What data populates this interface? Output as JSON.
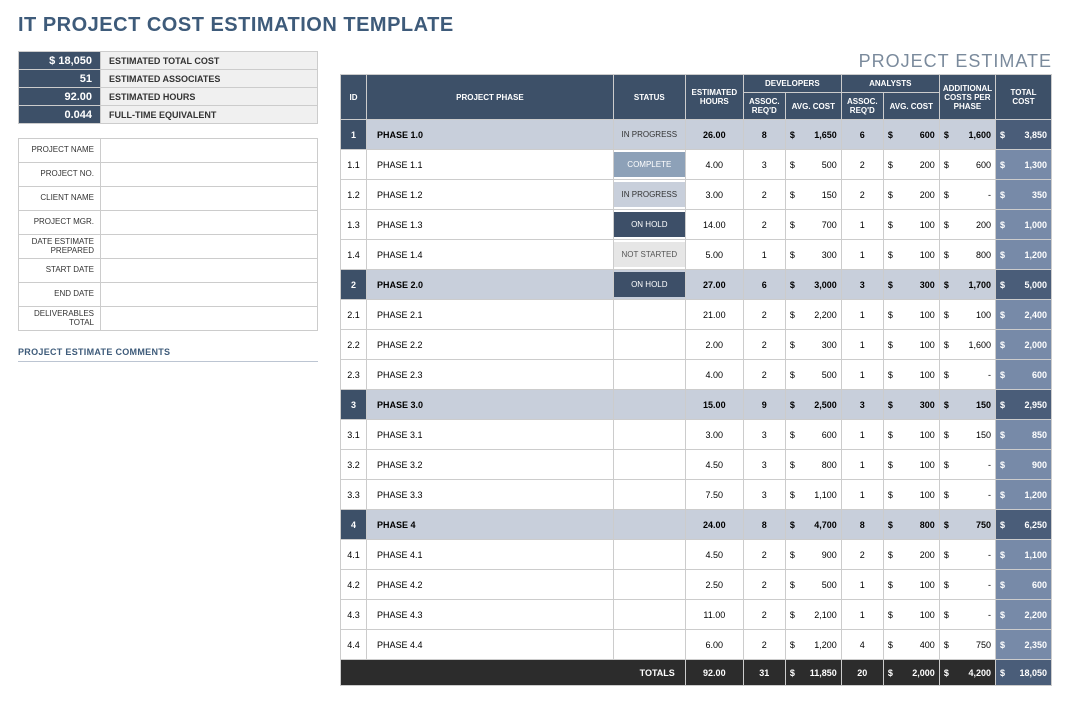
{
  "title": "IT PROJECT COST ESTIMATION TEMPLATE",
  "subtitle": "PROJECT ESTIMATE",
  "summary": {
    "total_cost": "$       18,050",
    "associates": "51",
    "hours": "92.00",
    "fte": "0.044",
    "labels": {
      "total_cost": "ESTIMATED TOTAL COST",
      "associates": "ESTIMATED ASSOCIATES",
      "hours": "ESTIMATED HOURS",
      "fte": "FULL-TIME EQUIVALENT"
    }
  },
  "info": {
    "labels": {
      "project_name": "PROJECT NAME",
      "project_no": "PROJECT NO.",
      "client_name": "CLIENT NAME",
      "project_mgr": "PROJECT MGR.",
      "date_prepared": "DATE ESTIMATE PREPARED",
      "start_date": "START DATE",
      "end_date": "END DATE",
      "deliverables": "DELIVERABLES TOTAL"
    },
    "values": {
      "project_name": "",
      "project_no": "",
      "client_name": "",
      "project_mgr": "",
      "date_prepared": "",
      "start_date": "",
      "end_date": "",
      "deliverables": ""
    }
  },
  "comments_heading": "PROJECT ESTIMATE COMMENTS",
  "headers": {
    "id": "ID",
    "phase": "PROJECT PHASE",
    "status": "STATUS",
    "hours": "ESTIMATED HOURS",
    "developers": "DEVELOPERS",
    "analysts": "ANALYSTS",
    "assoc_reqd": "ASSOC. REQ'D",
    "avg_cost": "AVG. COST",
    "additional": "ADDITIONAL COSTS PER PHASE",
    "total": "TOTAL COST",
    "totals_label": "TOTALS"
  },
  "status_classes": {
    "IN PROGRESS": "st-inprogress",
    "COMPLETE": "st-complete",
    "ON HOLD": "st-onhold",
    "NOT STARTED": "st-notstarted"
  },
  "rows": [
    {
      "type": "phase",
      "id": "1",
      "phase": "PHASE 1.0",
      "status": "IN PROGRESS",
      "hours": "26.00",
      "dev_n": "8",
      "dev_cost": "1,650",
      "an_n": "6",
      "an_cost": "600",
      "addl": "1,600",
      "total": "3,850"
    },
    {
      "type": "sub",
      "id": "1.1",
      "phase": "PHASE 1.1",
      "status": "COMPLETE",
      "hours": "4.00",
      "dev_n": "3",
      "dev_cost": "500",
      "an_n": "2",
      "an_cost": "200",
      "addl": "600",
      "total": "1,300"
    },
    {
      "type": "sub",
      "id": "1.2",
      "phase": "PHASE 1.2",
      "status": "IN PROGRESS",
      "hours": "3.00",
      "dev_n": "2",
      "dev_cost": "150",
      "an_n": "2",
      "an_cost": "200",
      "addl": "-",
      "total": "350"
    },
    {
      "type": "sub",
      "id": "1.3",
      "phase": "PHASE 1.3",
      "status": "ON HOLD",
      "hours": "14.00",
      "dev_n": "2",
      "dev_cost": "700",
      "an_n": "1",
      "an_cost": "100",
      "addl": "200",
      "total": "1,000"
    },
    {
      "type": "sub",
      "id": "1.4",
      "phase": "PHASE 1.4",
      "status": "NOT STARTED",
      "hours": "5.00",
      "dev_n": "1",
      "dev_cost": "300",
      "an_n": "1",
      "an_cost": "100",
      "addl": "800",
      "total": "1,200"
    },
    {
      "type": "phase",
      "id": "2",
      "phase": "PHASE 2.0",
      "status": "ON HOLD",
      "hours": "27.00",
      "dev_n": "6",
      "dev_cost": "3,000",
      "an_n": "3",
      "an_cost": "300",
      "addl": "1,700",
      "total": "5,000"
    },
    {
      "type": "sub",
      "id": "2.1",
      "phase": "PHASE 2.1",
      "status": "",
      "hours": "21.00",
      "dev_n": "2",
      "dev_cost": "2,200",
      "an_n": "1",
      "an_cost": "100",
      "addl": "100",
      "total": "2,400"
    },
    {
      "type": "sub",
      "id": "2.2",
      "phase": "PHASE 2.2",
      "status": "",
      "hours": "2.00",
      "dev_n": "2",
      "dev_cost": "300",
      "an_n": "1",
      "an_cost": "100",
      "addl": "1,600",
      "total": "2,000"
    },
    {
      "type": "sub",
      "id": "2.3",
      "phase": "PHASE 2.3",
      "status": "",
      "hours": "4.00",
      "dev_n": "2",
      "dev_cost": "500",
      "an_n": "1",
      "an_cost": "100",
      "addl": "-",
      "total": "600"
    },
    {
      "type": "phase",
      "id": "3",
      "phase": "PHASE 3.0",
      "status": "",
      "hours": "15.00",
      "dev_n": "9",
      "dev_cost": "2,500",
      "an_n": "3",
      "an_cost": "300",
      "addl": "150",
      "total": "2,950"
    },
    {
      "type": "sub",
      "id": "3.1",
      "phase": "PHASE 3.1",
      "status": "",
      "hours": "3.00",
      "dev_n": "3",
      "dev_cost": "600",
      "an_n": "1",
      "an_cost": "100",
      "addl": "150",
      "total": "850"
    },
    {
      "type": "sub",
      "id": "3.2",
      "phase": "PHASE 3.2",
      "status": "",
      "hours": "4.50",
      "dev_n": "3",
      "dev_cost": "800",
      "an_n": "1",
      "an_cost": "100",
      "addl": "-",
      "total": "900"
    },
    {
      "type": "sub",
      "id": "3.3",
      "phase": "PHASE 3.3",
      "status": "",
      "hours": "7.50",
      "dev_n": "3",
      "dev_cost": "1,100",
      "an_n": "1",
      "an_cost": "100",
      "addl": "-",
      "total": "1,200"
    },
    {
      "type": "phase",
      "id": "4",
      "phase": "PHASE 4",
      "status": "",
      "hours": "24.00",
      "dev_n": "8",
      "dev_cost": "4,700",
      "an_n": "8",
      "an_cost": "800",
      "addl": "750",
      "total": "6,250"
    },
    {
      "type": "sub",
      "id": "4.1",
      "phase": "PHASE 4.1",
      "status": "",
      "hours": "4.50",
      "dev_n": "2",
      "dev_cost": "900",
      "an_n": "2",
      "an_cost": "200",
      "addl": "-",
      "total": "1,100"
    },
    {
      "type": "sub",
      "id": "4.2",
      "phase": "PHASE 4.2",
      "status": "",
      "hours": "2.50",
      "dev_n": "2",
      "dev_cost": "500",
      "an_n": "1",
      "an_cost": "100",
      "addl": "-",
      "total": "600"
    },
    {
      "type": "sub",
      "id": "4.3",
      "phase": "PHASE 4.3",
      "status": "",
      "hours": "11.00",
      "dev_n": "2",
      "dev_cost": "2,100",
      "an_n": "1",
      "an_cost": "100",
      "addl": "-",
      "total": "2,200"
    },
    {
      "type": "sub",
      "id": "4.4",
      "phase": "PHASE 4.4",
      "status": "",
      "hours": "6.00",
      "dev_n": "2",
      "dev_cost": "1,200",
      "an_n": "4",
      "an_cost": "400",
      "addl": "750",
      "total": "2,350"
    }
  ],
  "totals": {
    "hours": "92.00",
    "dev_n": "31",
    "dev_cost": "11,850",
    "an_n": "20",
    "an_cost": "2,000",
    "addl": "4,200",
    "total": "18,050"
  }
}
